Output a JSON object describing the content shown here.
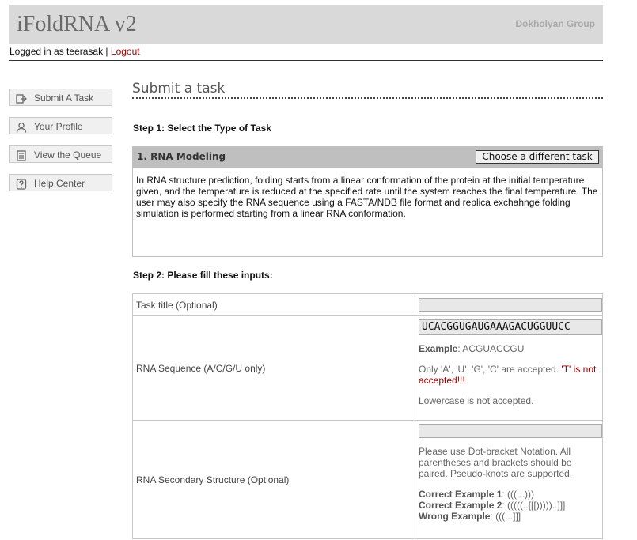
{
  "header": {
    "title": "iFoldRNA v2",
    "group": "Dokholyan Group"
  },
  "login": {
    "prefix": "Logged in as teerasak",
    "separator": " | ",
    "logout": "Logout"
  },
  "sidebar": [
    {
      "label": "Submit A Task",
      "icon": "submit-icon"
    },
    {
      "label": "Your Profile",
      "icon": "user-icon"
    },
    {
      "label": "View the Queue",
      "icon": "queue-icon"
    },
    {
      "label": "Help Center",
      "icon": "help-icon"
    }
  ],
  "main": {
    "title": "Submit a task",
    "step1": "Step 1: Select the Type of Task",
    "task": {
      "name": "1. RNA Modeling",
      "change_button": "Choose a different task",
      "description": "In RNA structure prediction, folding starts from a linear conformation of the protein at the initial temperature given, and the temperature is reduced at the specified rate until the system reaches the final temperature. The user may also specify the RNA sequence using a FASTA/NDB file format and replica exchahnge folding simulation is performed starting from a linear RNA conformation."
    },
    "step2": "Step 2: Please fill these inputs:",
    "inputs": {
      "title_label": "Task title (Optional)",
      "title_value": "",
      "seq_label": "RNA Sequence (A/C/G/U only)",
      "seq_value": "UCACGGUGAUGAAAGACUGGUUCC",
      "seq_example_label": "Example",
      "seq_example_value": ": ACGUACCGU",
      "seq_only": "Only 'A', 'U', 'G', 'C' are accepted. ",
      "seq_not_t": "'T' is not accepted!!!",
      "seq_lowercase": "Lowercase is not accepted.",
      "ss_label": "RNA Secondary Structure (Optional)",
      "ss_value": "",
      "ss_note": "Please use Dot-bracket Notation. All parentheses and brackets should be paired. Pseudo-knots are supported.",
      "ss_ex1_label": "Correct Example 1",
      "ss_ex1_value": ": (((...)))",
      "ss_ex2_label": "Correct Example 2",
      "ss_ex2_value": ": (((((..[[[)))))..]]]",
      "ss_wrong_label": "Wrong Example",
      "ss_wrong_value": ": (((...]]]"
    }
  }
}
